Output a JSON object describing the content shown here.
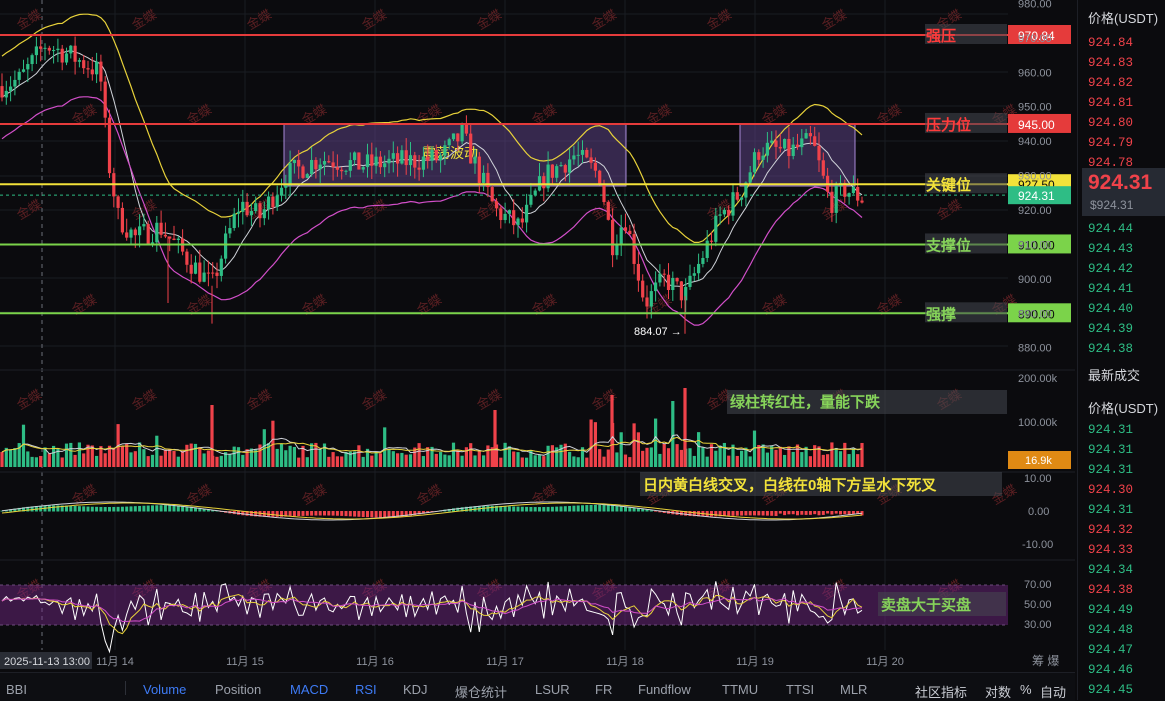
{
  "chart_data": {
    "type": "candlestick",
    "price_axis": {
      "ticks": [
        "980.00",
        "970.00",
        "960.00",
        "950.00",
        "940.00",
        "930.00",
        "920.00",
        "910.00",
        "900.00",
        "890.00",
        "880.00"
      ]
    },
    "volume_axis": {
      "ticks": [
        "200.00k",
        "100.00k"
      ],
      "current_label": "16.9k"
    },
    "macd_axis": {
      "ticks": [
        "10.00",
        "0.00",
        "-10.00"
      ]
    },
    "rsi_axis": {
      "ticks": [
        "70.00",
        "50.00",
        "30.00"
      ],
      "band": [
        30,
        70
      ]
    },
    "x_ticks": [
      "11月 14",
      "11月 15",
      "11月 16",
      "11月 17",
      "11月 18",
      "11月 19",
      "11月 20"
    ],
    "crosshair_time": "2025-11-13 13:00",
    "last_price": 924.31,
    "last_price_label": "924.31",
    "low_marker": "884.07 →",
    "levels": [
      {
        "price": 970.84,
        "label": "970.84",
        "name": "强压",
        "color": "#e53b3b",
        "name_color": "#ff3b3b"
      },
      {
        "price": 945.0,
        "label": "945.00",
        "name": "压力位",
        "color": "#e53b3b",
        "name_color": "#ff3b3b"
      },
      {
        "price": 927.5,
        "label": "927.50",
        "name": "关键位",
        "color": "#f2e23a",
        "name_color": "#f2e23a"
      },
      {
        "price": 910.0,
        "label": "910.00",
        "name": "支撑位",
        "color": "#7bd34a",
        "name_color": "#86d35a"
      },
      {
        "price": 890.0,
        "label": "890.00",
        "name": "强撑",
        "color": "#7bd34a",
        "name_color": "#86d35a"
      }
    ],
    "range_box_label": "震荡波动",
    "annotations": [
      "绿柱转红柱，量能下跌",
      "日内黄白线交叉，白线在0轴下方呈水下死叉",
      "卖盘大于买盘"
    ],
    "watermark": "金蝶"
  },
  "orderbook": {
    "title": "价格(USDT)",
    "asks": [
      "924.84",
      "924.83",
      "924.82",
      "924.81",
      "924.80",
      "924.79",
      "924.78"
    ],
    "last": "924.31",
    "last_sub": "$924.31",
    "bids": [
      "924.44",
      "924.43",
      "924.42",
      "924.41",
      "924.40",
      "924.39",
      "924.38"
    ],
    "trades_title": "最新成交",
    "trades_price_title": "价格(USDT)",
    "trades": [
      {
        "p": "924.31",
        "c": "#2ebd85"
      },
      {
        "p": "924.31",
        "c": "#2ebd85"
      },
      {
        "p": "924.31",
        "c": "#2ebd85"
      },
      {
        "p": "924.30",
        "c": "#f0424a"
      },
      {
        "p": "924.31",
        "c": "#2ebd85"
      },
      {
        "p": "924.32",
        "c": "#f0424a"
      },
      {
        "p": "924.33",
        "c": "#f0424a"
      },
      {
        "p": "924.34",
        "c": "#2ebd85"
      },
      {
        "p": "924.38",
        "c": "#f0424a"
      },
      {
        "p": "924.49",
        "c": "#2ebd85"
      },
      {
        "p": "924.48",
        "c": "#2ebd85"
      },
      {
        "p": "924.47",
        "c": "#2ebd85"
      },
      {
        "p": "924.46",
        "c": "#2ebd85"
      },
      {
        "p": "924.45",
        "c": "#2ebd85"
      }
    ]
  },
  "bottombar": {
    "tabs": [
      "BBI",
      "Volume",
      "Position",
      "MACD",
      "RSI",
      "KDJ",
      "爆仓统计",
      "LSUR",
      "FR",
      "Fundflow",
      "TTMU",
      "TTSI",
      "MLR"
    ],
    "active_tabs": [
      "Volume",
      "MACD",
      "RSI"
    ],
    "right": [
      "社区指标",
      "对数",
      "%",
      "自动"
    ],
    "corner": "筹 爆"
  },
  "colors": {
    "up": "#2ebd85",
    "down": "#f0424a",
    "bg": "#0b0b0e",
    "grid": "#1a1c22",
    "box": "#6a4c9c",
    "ma_white": "#cfd2d8",
    "ma_yellow": "#e8d23a",
    "boll_pink": "#d24fc9"
  }
}
